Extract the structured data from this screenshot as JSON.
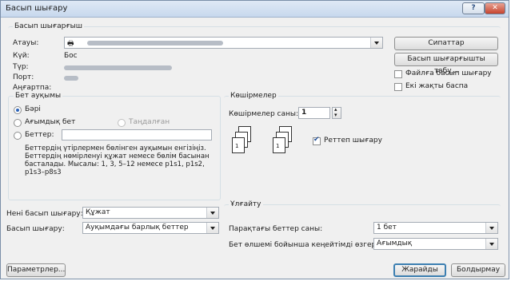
{
  "window": {
    "title": "Басып шығару",
    "help_label": "?",
    "close_label": "✕"
  },
  "printer": {
    "group_title": "Басып шығарғыш",
    "name_label": "Атауы:",
    "status_label": "Күй:",
    "status_value": "Бос",
    "type_label": "Түр:",
    "port_label": "Порт:",
    "comment_label": "Аңғартпа:",
    "properties_button": "Сипаттар",
    "find_printer_button": "Басып шығарғышты табу...",
    "print_to_file_label": "Файлға басып шығару",
    "print_to_file_checked": false,
    "duplex_label": "Екі жақты баспа",
    "duplex_checked": false
  },
  "page_range": {
    "group_title": "Бет ауқымы",
    "all_label": "Бәрі",
    "all_selected": true,
    "current_page_label": "Ағымдық бет",
    "selection_label": "Таңдалған",
    "pages_label": "Беттер:",
    "pages_value": "",
    "help_text": [
      "Беттердің үтірлермен бөлінген ауқымын енгізіңіз.",
      "Беттердің нөмірленуі құжат немесе бөлім басынан",
      "басталады. Мысалы: 1, 3, 5–12 немесе p1s1, p1s2,",
      "p1s3–p8s3"
    ]
  },
  "copies": {
    "group_title": "Көшірмелер",
    "count_label": "Көшірмелер саны:",
    "count_value": "1",
    "collate_label": "Реттеп шығару",
    "collate_checked": true,
    "page_numbers": [
      "1",
      "2",
      "3",
      "1",
      "2",
      "3"
    ]
  },
  "print_what": {
    "label": "Нені басып шығару:",
    "value": "Құжат"
  },
  "print": {
    "label": "Басып шығару:",
    "value": "Ауқымдағы барлық беттер"
  },
  "zoom": {
    "group_title": "Ұлғайту",
    "pages_per_sheet_label": "Парақтағы беттер саны:",
    "pages_per_sheet_value": "1 бет",
    "scale_label": "Бет өлшемі бойынша кеңейтімді өзгерту:",
    "scale_value": "Ағымдық"
  },
  "footer": {
    "options_button": "Параметрлер...",
    "ok_button": "Жарайды",
    "cancel_button": "Болдырмау"
  }
}
